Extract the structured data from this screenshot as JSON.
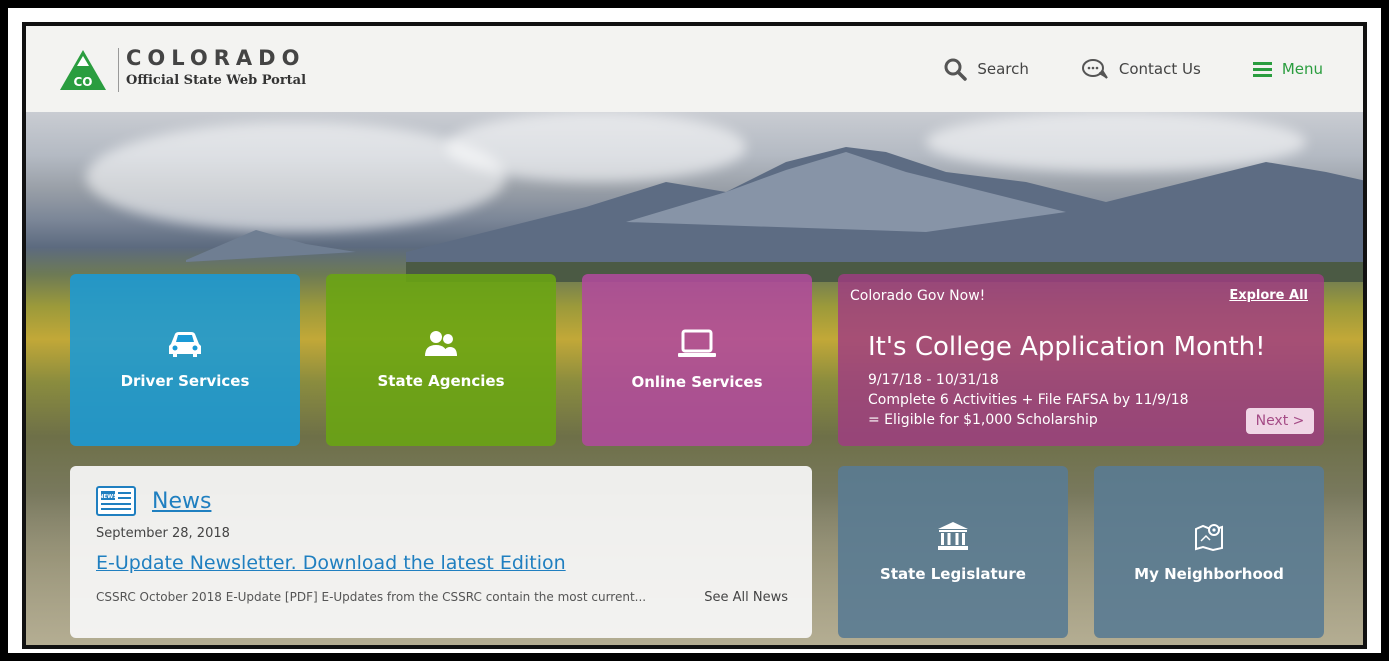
{
  "header": {
    "logo_abbr": "CO",
    "logo_title": "COLORADO",
    "logo_subtitle": "Official State Web Portal",
    "nav": {
      "search": "Search",
      "contact": "Contact Us",
      "menu": "Menu"
    }
  },
  "tiles": [
    {
      "label": "Driver Services",
      "icon": "car-icon",
      "color": "#1a9ad6"
    },
    {
      "label": "State Agencies",
      "icon": "people-icon",
      "color": "#6aa512"
    },
    {
      "label": "Online Services",
      "icon": "laptop-icon",
      "color": "#b04a9c"
    },
    {
      "label": "State Legislature",
      "icon": "capitol-icon",
      "color": "#5a7b92"
    },
    {
      "label": "My Neighborhood",
      "icon": "map-pin-icon",
      "color": "#5a7b92"
    }
  ],
  "promo": {
    "kicker": "Colorado Gov Now!",
    "explore": "Explore All",
    "title": "It's College Application Month!",
    "line1": "9/17/18 - 10/31/18",
    "line2": "Complete 6 Activities + File FAFSA by 11/9/18",
    "line3": "= Eligible for $1,000 Scholarship",
    "next": "Next >"
  },
  "news": {
    "title": "News",
    "date": "September 28, 2018",
    "headline": "E-Update Newsletter. Download the latest Edition",
    "snippet": "CSSRC October 2018 E-Update [PDF] E-Updates from the CSSRC contain the most current...",
    "see_all": "See All News",
    "icon_text": "NEWS"
  },
  "colors": {
    "brand_green": "#2a9d3f",
    "link_blue": "#1f7fc0"
  }
}
